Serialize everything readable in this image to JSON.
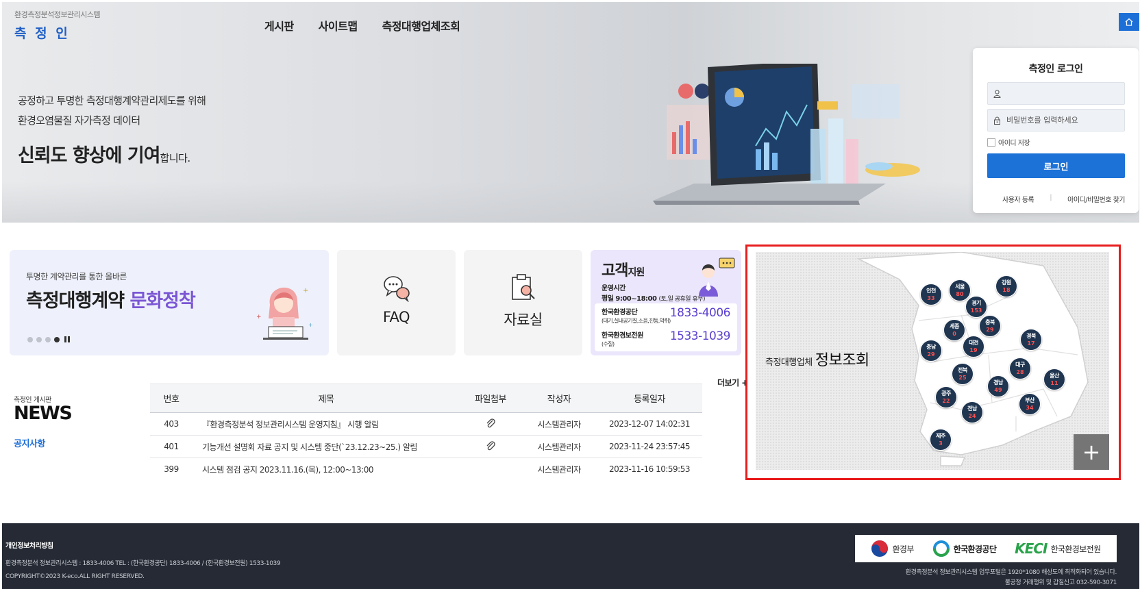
{
  "brand": {
    "sub": "환경측정분석정보관리시스템",
    "main": "측 정 인"
  },
  "nav": {
    "items": [
      "게시판",
      "사이트맵",
      "측정대행업체조회"
    ]
  },
  "hero": {
    "line1": "공정하고 투명한 측정대행계약관리제도를 위해",
    "line2": "환경오염물질 자가측정 데이터",
    "line3_bold": "신뢰도 향상에 기여",
    "line3_tail": "합니다."
  },
  "login": {
    "title": "측정인 로그인",
    "id_placeholder": "",
    "pw_placeholder": "비밀번호를 입력하세요",
    "remember": "아이디 저장",
    "button": "로그인",
    "register": "사용자 등록",
    "find": "아이디/비밀번호 찾기"
  },
  "banner": {
    "small": "투명한 계약관리를 통한 올바른",
    "large_main": "측정대행계약 ",
    "large_accent": "문화정착"
  },
  "tiles": {
    "faq": "FAQ",
    "data": "자료실"
  },
  "support": {
    "title_big": "고객",
    "title_small": "지원",
    "hours_label": "운영시간",
    "hours": "평일 9:00~18:00 ",
    "hours_note": "(토,일 공휴일 휴무)",
    "org1": {
      "name": "한국환경공단",
      "desc": "(대기,실내공기질,소음,진동,악취)",
      "phone": "1833-4006"
    },
    "org2": {
      "name": "한국환경보전원",
      "desc": "(수질)",
      "phone": "1533-1039"
    }
  },
  "news": {
    "caption": "측정인 게시판",
    "title": "NEWS",
    "tab": "공지사항",
    "more": "더보기 +",
    "headers": {
      "no": "번호",
      "title": "제목",
      "attach": "파일첨부",
      "author": "작성자",
      "date": "등록일자"
    },
    "rows": [
      {
        "no": "403",
        "title": "『환경측정분석 정보관리시스템 운영지침』 시행 알림",
        "attach": true,
        "author": "시스템관리자",
        "date": "2023-12-07 14:02:31"
      },
      {
        "no": "401",
        "title": "기능개선 설명회 자료 공지 및 시스템 중단(`23.12.23~25.) 알림",
        "attach": true,
        "author": "시스템관리자",
        "date": "2023-11-24 23:57:45"
      },
      {
        "no": "399",
        "title": "시스템 점검 공지 2023.11.16.(목), 12:00~13:00",
        "attach": false,
        "author": "시스템관리자",
        "date": "2023-11-16 10:59:53"
      }
    ]
  },
  "map": {
    "label_small": "측정대행업체",
    "label_big": "정보조회",
    "regions": [
      {
        "name": "인천",
        "count": "33"
      },
      {
        "name": "서울",
        "count": "80"
      },
      {
        "name": "강원",
        "count": "18"
      },
      {
        "name": "경기",
        "count": "153"
      },
      {
        "name": "충북",
        "count": "29"
      },
      {
        "name": "세종",
        "count": "0"
      },
      {
        "name": "대전",
        "count": "19"
      },
      {
        "name": "충남",
        "count": "29"
      },
      {
        "name": "경북",
        "count": "17"
      },
      {
        "name": "전북",
        "count": "25"
      },
      {
        "name": "대구",
        "count": "28"
      },
      {
        "name": "경남",
        "count": "49"
      },
      {
        "name": "울산",
        "count": "11"
      },
      {
        "name": "광주",
        "count": "22"
      },
      {
        "name": "전남",
        "count": "24"
      },
      {
        "name": "부산",
        "count": "34"
      },
      {
        "name": "제주",
        "count": "3"
      }
    ],
    "plus": "+"
  },
  "footer": {
    "privacy": "개인정보처리방침",
    "info": "환경측정분석 정보관리시스템 : 1833-4006   TEL : (한국환경공단) 1833-4006   / (한국환경보전원) 1533-1039",
    "copyright": "COPYRIGHT©2023 K-eco.ALL RIGHT RESERVED.",
    "logo1": "환경부",
    "logo2": "한국환경공단",
    "logo3_mark": "KECI",
    "logo3": "한국환경보전원",
    "note1": "환경측정분석 정보관리시스템 업무포털은 1920*1080 해상도에 최적화되어 있습니다.",
    "note2": "불공정 거래행위 및 갑질신고 032-590-3071"
  }
}
